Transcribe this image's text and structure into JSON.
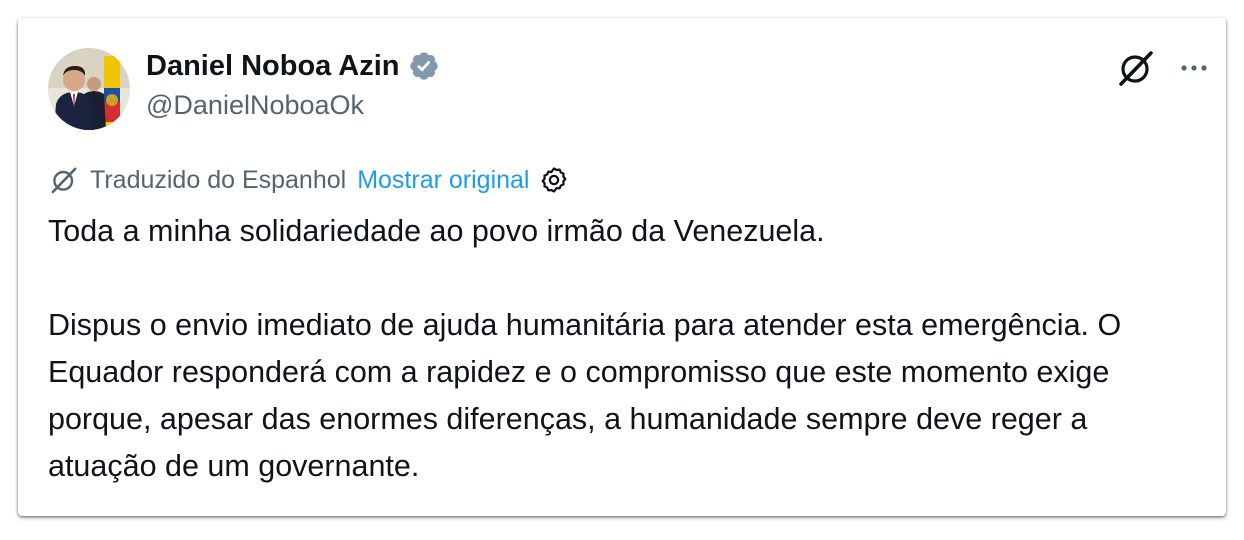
{
  "author": {
    "display_name": "Daniel Noboa Azin",
    "handle": "@DanielNoboaOk",
    "verified": true,
    "verified_color": "#829aab"
  },
  "translation": {
    "label": "Traduzido do Espanhol",
    "show_original": "Mostrar original"
  },
  "tweet": {
    "paragraph_1": "Toda a minha solidariedade ao povo irmão da Venezuela.",
    "paragraph_2": "Dispus o envio imediato de ajuda humanitária para atender esta emergência. O Equador responderá com a rapidez e o compromisso que este momento exige porque, apesar das enormes diferenças, a humanidade sempre deve reger a atuação de um governante."
  },
  "icons": {
    "avatar": "avatar",
    "verified": "verified-badge-icon",
    "grok": "grok-icon",
    "more": "more-icon",
    "translate": "translate-icon",
    "settings": "settings-icon"
  },
  "colors": {
    "text_primary": "#0f1419",
    "text_secondary": "#536471",
    "link": "#1d9bf0"
  }
}
